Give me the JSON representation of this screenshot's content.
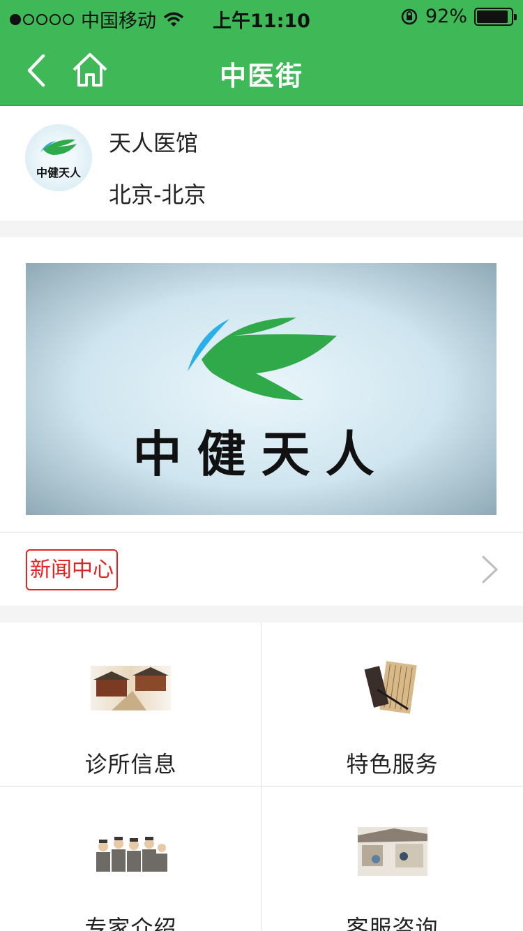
{
  "status_bar": {
    "carrier": "中国移动",
    "time": "上午11:10",
    "battery": "92%",
    "battery_level": 0.92
  },
  "navbar": {
    "title": "中医街"
  },
  "clinic": {
    "name": "天人医馆",
    "location": "北京-北京",
    "logo_text": "中健天人"
  },
  "banner": {
    "logo_text": "中健天人"
  },
  "news": {
    "label": "新闻中心"
  },
  "grid": {
    "items": [
      {
        "label": "诊所信息"
      },
      {
        "label": "特色服务"
      },
      {
        "label": "专家介绍"
      },
      {
        "label": "客服咨询"
      }
    ]
  },
  "colors": {
    "header": "#3fb957",
    "news_badge": "#e52222"
  }
}
